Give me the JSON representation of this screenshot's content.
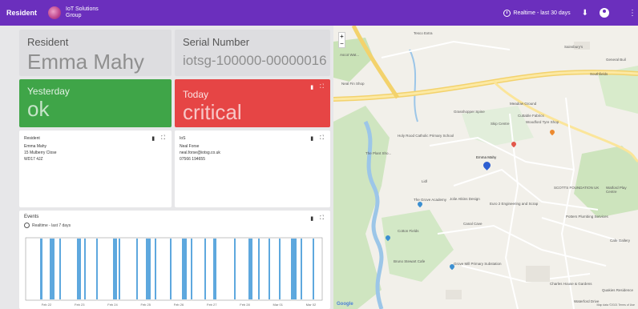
{
  "header": {
    "title": "Resident",
    "brand_line1": "IoT Solutions",
    "brand_line2": "Group",
    "timerange": "Realtime - last 30 days"
  },
  "resident_card": {
    "label": "Resident",
    "value": "Emma Mahy"
  },
  "serial_card": {
    "label": "Serial Number",
    "value": "iotsg-100000-00000016"
  },
  "yesterday_card": {
    "label": "Yesterday",
    "value": "ok",
    "color": "#3fa548"
  },
  "today_card": {
    "label": "Today",
    "value": "critical",
    "color": "#e64545"
  },
  "resident_details": {
    "title": "Resident",
    "lines": [
      "Emma Mahy",
      "15 Mulberry Close",
      "WD17 4JZ"
    ]
  },
  "contact_details": {
    "title": "IoS",
    "lines": [
      "Neal Forse",
      "neal.forse@iotsg.co.uk",
      "07566 194655"
    ]
  },
  "events": {
    "title": "Events",
    "timerange": "Realtime - last 7 days",
    "x_ticks": [
      "Feb 22",
      "Feb 23",
      "Feb 24",
      "Feb 25",
      "Feb 26",
      "Feb 27",
      "Feb 28",
      "Mar 01",
      "Mar 02"
    ],
    "bar_color": "#5ea8de"
  },
  "map": {
    "zoom_in": "+",
    "zoom_out": "−",
    "google": "Google",
    "terms": "Map data ©2021  Terms of Use",
    "labels": [
      "Ascot Wat...",
      "Tesco Extra",
      "Neal Fin Shop",
      "Sainsbury's",
      "General Buil",
      "Southfields",
      "Meadow Ground",
      "Cuttable Fabrics",
      "Grasshopper Spine",
      "Skip Centre",
      "Woodford Tyre Shop",
      "Emma Mahy",
      "Holy Rood Catholic Primary School",
      "The Plant Sho...",
      "Lidl",
      "The Grove Academy",
      "Jolie Atkins Design",
      "Euro 2 Engineering and Scrap",
      "Canal Cave",
      "Cotton Fields",
      "Watford Play Centre",
      "SCOTTS FOUNDATION UK",
      "Potters Plumbing Services",
      "Cafe Gallery",
      "Bruno Stewart Cafe",
      "Grove Mill Primary Substation",
      "Charles House & Gardens",
      "Quakies Residence",
      "Waterford Drive"
    ]
  }
}
